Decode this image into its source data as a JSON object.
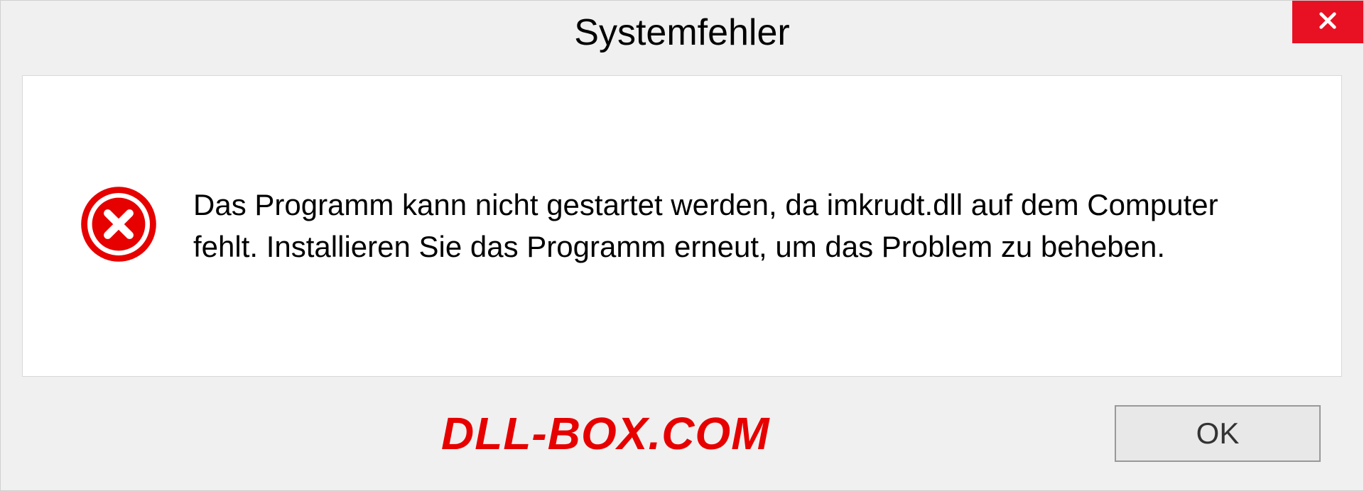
{
  "dialog": {
    "title": "Systemfehler",
    "message": "Das Programm kann nicht gestartet werden, da imkrudt.dll auf dem Computer fehlt. Installieren Sie das Programm erneut, um das Problem zu beheben.",
    "ok_label": "OK"
  },
  "watermark": "DLL-BOX.COM",
  "colors": {
    "close_bg": "#e81123",
    "error_red": "#e60000",
    "watermark_red": "#e60000"
  }
}
